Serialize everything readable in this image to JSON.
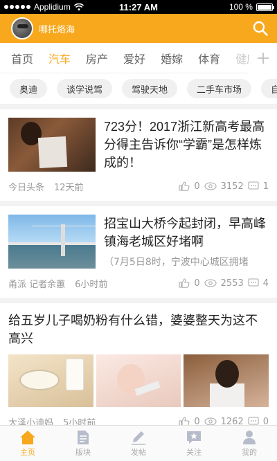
{
  "status_bar": {
    "carrier": "Applidium",
    "time": "11:27 AM",
    "battery_text": "100 %",
    "battery_level": 1.0
  },
  "header": {
    "title": "哪托烙海",
    "accent_color": "#f8a81c",
    "avatar_icon": "user-avatar",
    "search_icon": "search-icon"
  },
  "tabs": [
    {
      "label": "首页"
    },
    {
      "label": "汽车"
    },
    {
      "label": "房产"
    },
    {
      "label": "爱好"
    },
    {
      "label": "婚嫁"
    },
    {
      "label": "体育"
    },
    {
      "label": "健康"
    }
  ],
  "active_tab": "汽车",
  "chips": [
    {
      "label": "奥迪"
    },
    {
      "label": "谈学说驾"
    },
    {
      "label": "驾驶天地"
    },
    {
      "label": "二手车市场"
    },
    {
      "label": "自"
    }
  ],
  "articles": [
    {
      "title": "723分！2017浙江新高考最高分得主告诉你“学霸”是怎样炼成的！",
      "source": "今日头条",
      "time": "12天前",
      "likes": "0",
      "views": "3152",
      "comments": "1"
    },
    {
      "title": "招宝山大桥今起封闭，早高峰镇海老城区好堵啊",
      "snippet": "（7月5日8时，宁波中心城区拥堵",
      "source": "甬派 记者余蕙",
      "time": "6小时前",
      "likes": "0",
      "views": "2553",
      "comments": "4"
    },
    {
      "title": "给五岁儿子喝奶粉有什么错，婆婆整天为这不高兴",
      "source": "大泽小迪妈",
      "time": "5小时前",
      "likes": "0",
      "views": "1262",
      "comments": "0"
    }
  ],
  "bottom_nav": [
    {
      "label": "主页",
      "icon": "home-icon"
    },
    {
      "label": "版块",
      "icon": "document-icon"
    },
    {
      "label": "发帖",
      "icon": "pencil-icon"
    },
    {
      "label": "关注",
      "icon": "star-chat-icon"
    },
    {
      "label": "我的",
      "icon": "person-icon"
    }
  ]
}
